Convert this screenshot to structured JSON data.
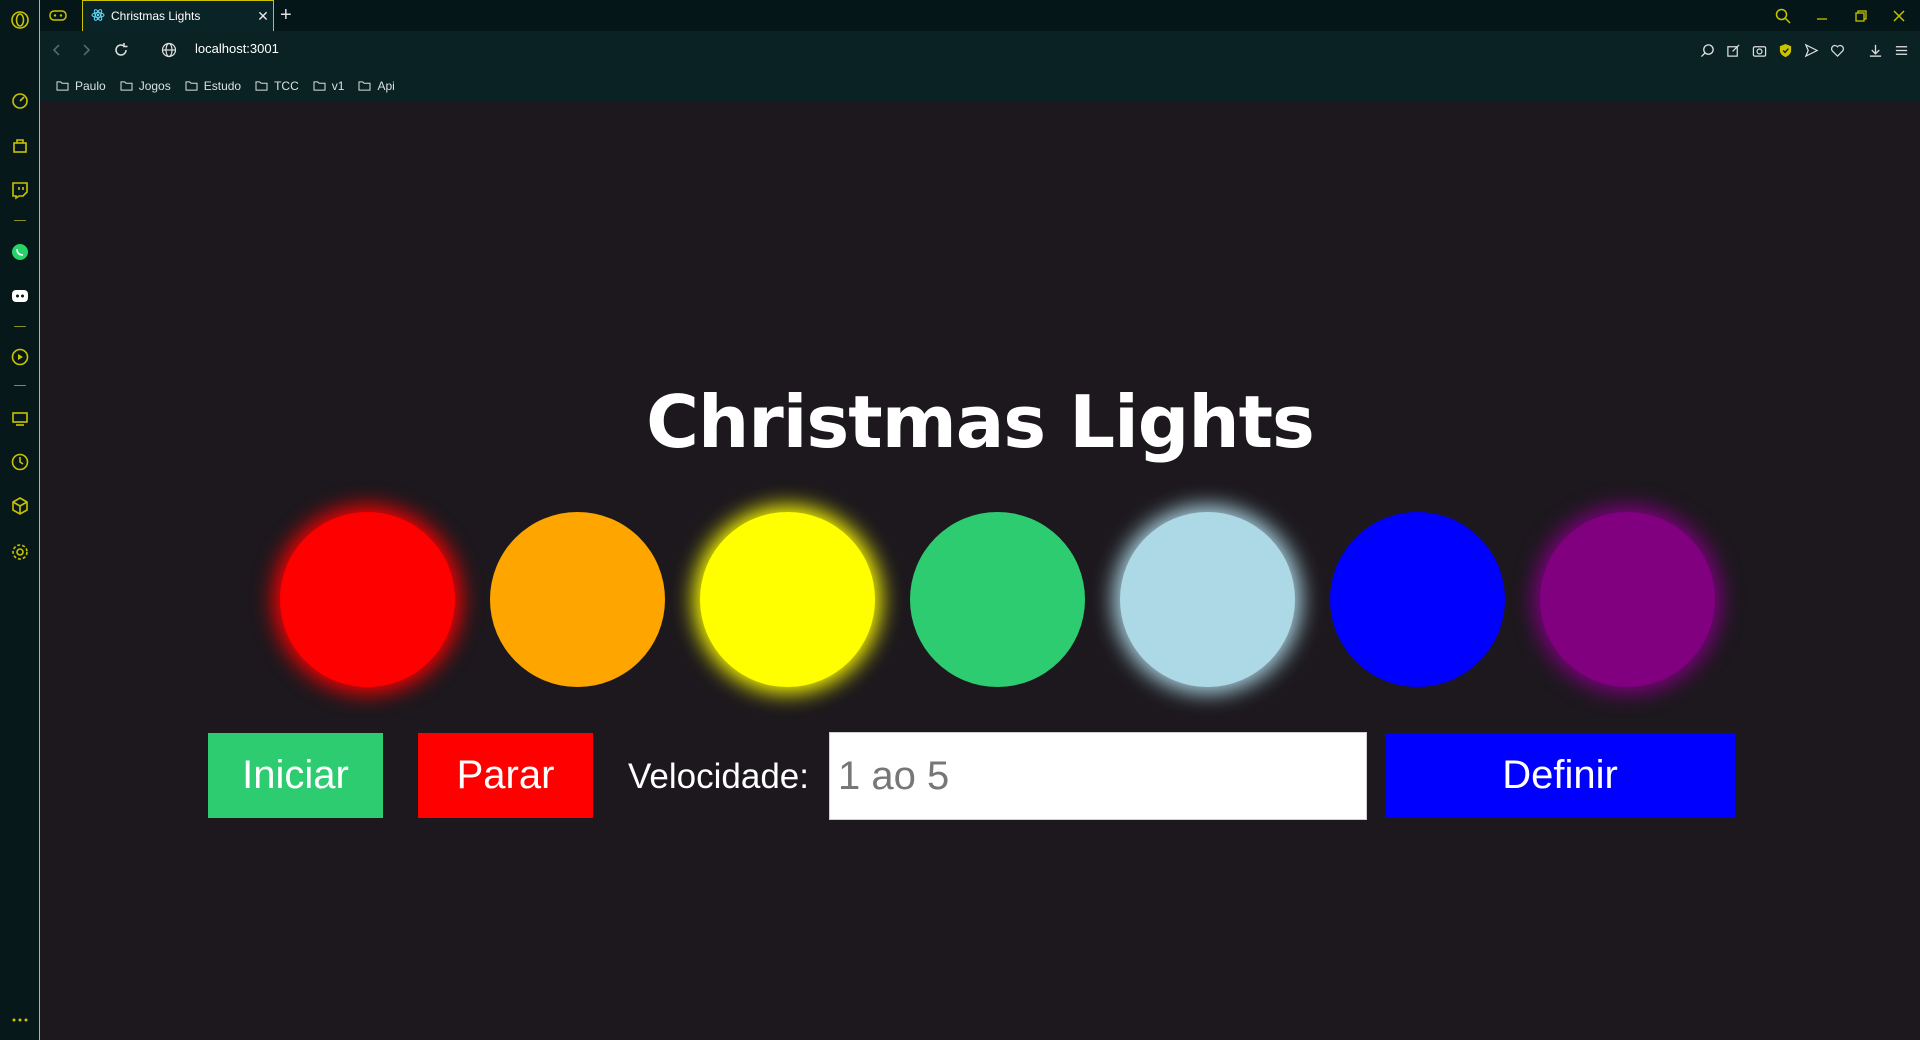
{
  "browser": {
    "tab_title": "Christmas Lights",
    "tab_close": "✕",
    "new_tab": "+",
    "url": "localhost:3001",
    "bookmarks": [
      "Paulo",
      "Jogos",
      "Estudo",
      "TCC",
      "v1",
      "Api"
    ]
  },
  "page": {
    "title": "Christmas Lights",
    "lights": [
      {
        "color": "#ff0000",
        "glow": true
      },
      {
        "color": "#ffa500",
        "glow": false
      },
      {
        "color": "#ffff00",
        "glow": true
      },
      {
        "color": "#2ecc71",
        "glow": false
      },
      {
        "color": "#add8e6",
        "glow": true
      },
      {
        "color": "#0000ff",
        "glow": false
      },
      {
        "color": "#800080",
        "glow": true
      }
    ],
    "start_label": "Iniciar",
    "stop_label": "Parar",
    "speed_label": "Velocidade:",
    "speed_placeholder": "1 ao 5",
    "set_label": "Definir"
  },
  "colors": {
    "accent": "#c9c300",
    "background": "#1c181d",
    "start_button": "#2ecc71",
    "stop_button": "#ff0000",
    "set_button": "#0000ff"
  }
}
